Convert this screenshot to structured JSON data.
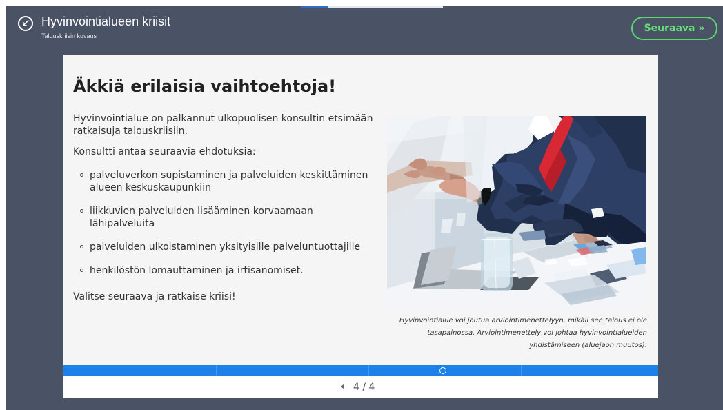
{
  "header": {
    "title": "Hyvinvointialueen kriisit",
    "subtitle": "Talouskriisin kuvaus",
    "next_label": "Seuraava »"
  },
  "slide": {
    "heading": "Äkkiä erilaisia vaihtoehtoja!",
    "intro": "Hyvinvointialue on palkannut ulkopuolisen konsultin etsimään ratkaisuja talouskriisiin.",
    "prompt": "Konsultti antaa seuraavia ehdotuksia:",
    "options": [
      "palveluverkon supistaminen ja palveluiden keskittäminen alueen keskuskaupunkiin",
      "liikkuvien palveluiden lisääminen korvaamaan lähipalveluita",
      "palveluiden ulkoistaminen yksityisille palveluntuottajille",
      "henkilöstön lomauttaminen ja irtisanomiset."
    ],
    "outro": "Valitse seuraava ja ratkaise kriisi!",
    "caption": "Hyvinvointialue voi joutua arviointimenettelyyn, mikäli sen talous ei ole tasapainossa. Arviointimenettely voi johtaa hyvinvointialueiden yhdistämiseen (aluejaon muutos)."
  },
  "pager": {
    "text": "4 / 4"
  },
  "icons": {
    "back": "back-icon",
    "previous": "previous-arrow-icon",
    "progress_marker": "progress-marker-icon"
  },
  "colors": {
    "background": "#4a5366",
    "accent": "#59d96c",
    "progress": "#1d82e7"
  }
}
